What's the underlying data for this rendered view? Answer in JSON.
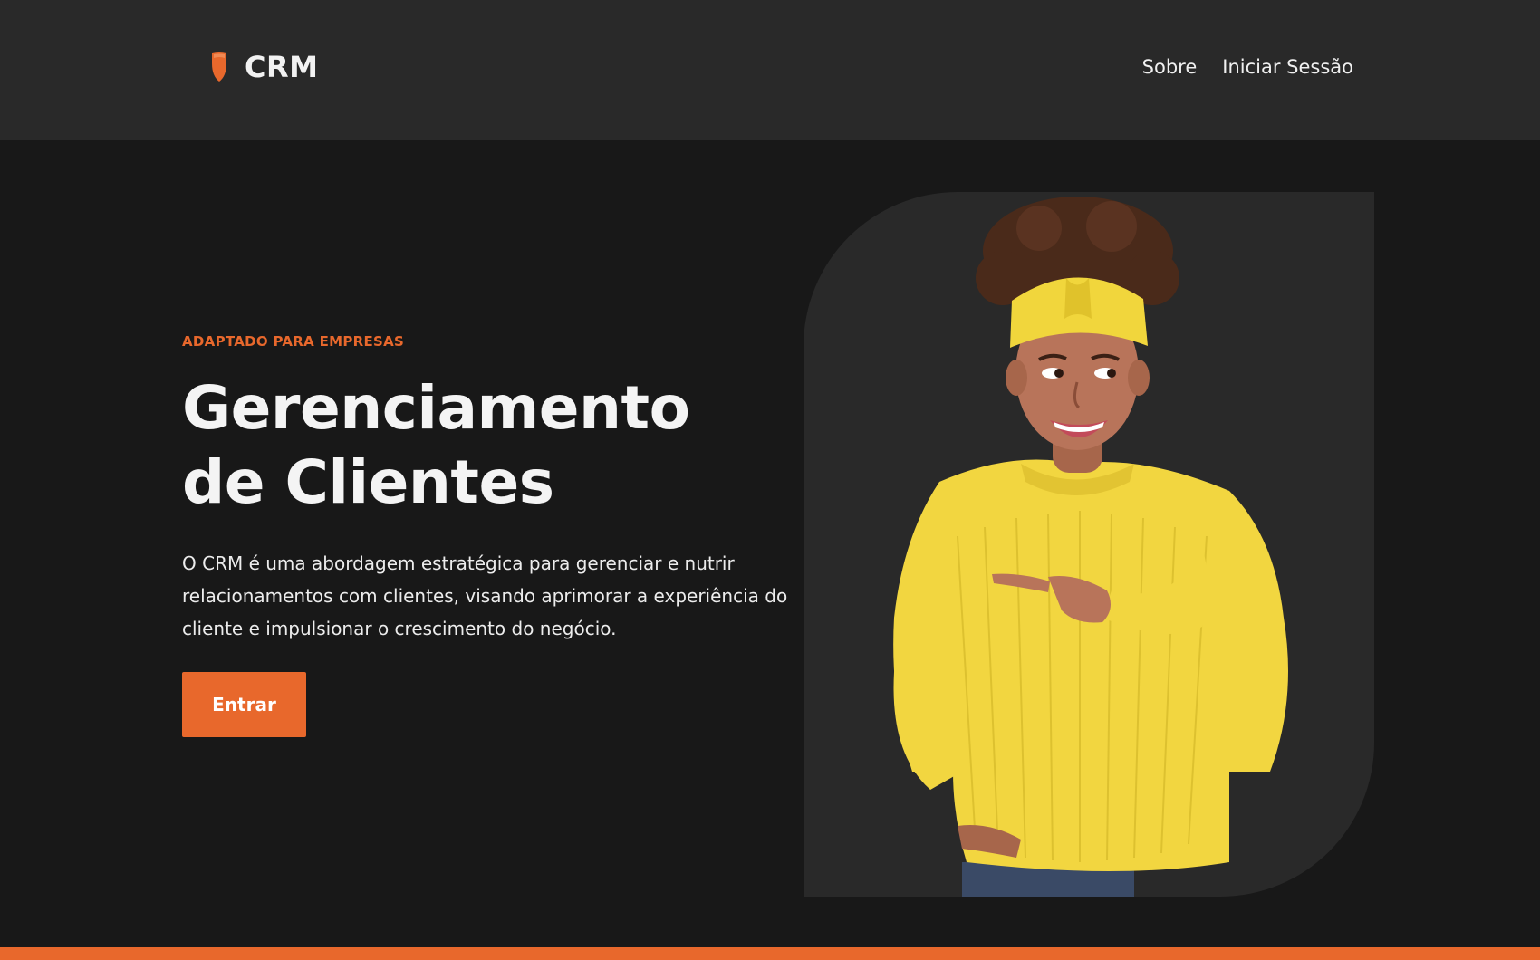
{
  "header": {
    "brand": "CRM",
    "logo_icon": "shield-drop-icon",
    "nav": [
      {
        "label": "Sobre"
      },
      {
        "label": "Iniciar Sessão"
      }
    ]
  },
  "hero": {
    "eyebrow": "ADAPTADO PARA EMPRESAS",
    "title_line1": "Gerenciamento",
    "title_line2": "de Clientes",
    "description": "O CRM é uma abordagem estratégica para gerenciar e nutrir relacionamentos com clientes, visando aprimorar a experiência do cliente e impulsionar o crescimento do negócio.",
    "cta_label": "Entrar",
    "image_subject": "smiling woman in yellow sweater and headband pointing"
  },
  "colors": {
    "accent": "#e8682c",
    "header_bg": "#292929",
    "page_bg": "#181818",
    "card_bg": "#292929",
    "sweater": "#f2d640"
  }
}
